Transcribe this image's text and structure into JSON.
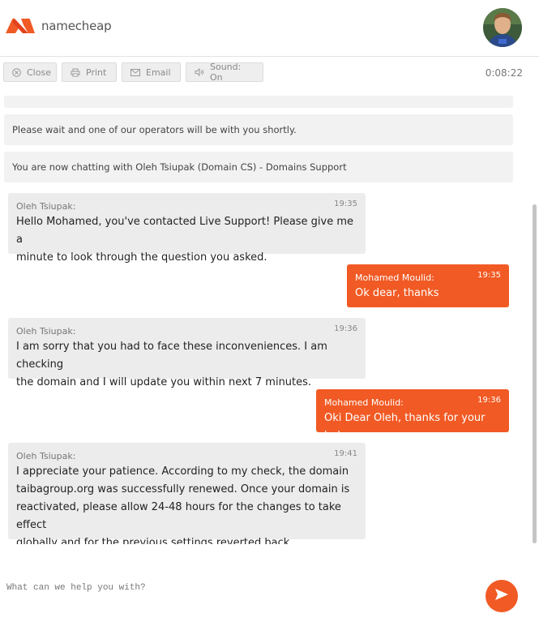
{
  "header": {
    "logo_text": "namecheap",
    "brand_color": "#f15a24"
  },
  "toolbar": {
    "close_label": "Close",
    "print_label": "Print",
    "email_label": "Email",
    "sound_label": "Sound: On",
    "timer": "0:08:22"
  },
  "system_messages": [
    "Please wait and one of our operators will be with you shortly.",
    "You are now chatting with Oleh Tsiupak (Domain CS) - Domains Support"
  ],
  "messages": [
    {
      "sender": "Oleh Tsiupak:",
      "time": "19:35",
      "role": "operator",
      "lines": [
        "Hello Mohamed, you've contacted Live Support! Please give me a",
        "minute to look through the question you asked."
      ]
    },
    {
      "sender": "Mohamed Moulid:",
      "time": "19:35",
      "role": "user",
      "lines": [
        "Ok dear, thanks"
      ]
    },
    {
      "sender": "Oleh Tsiupak:",
      "time": "19:36",
      "role": "operator",
      "lines": [
        "I am sorry that you had to face these inconveniences. I am checking",
        "the domain and I will update you within next 7 minutes."
      ]
    },
    {
      "sender": "Mohamed Moulid:",
      "time": "19:36",
      "role": "user",
      "lines": [
        "Oki Dear Oleh, thanks for your help"
      ]
    },
    {
      "sender": "Oleh Tsiupak:",
      "time": "19:41",
      "role": "operator",
      "lines": [
        "I appreciate your patience. According to my check, the domain",
        "taibagroup.org was successfully renewed. Once your domain is",
        "reactivated, please allow 24-48 hours for the changes to take effect",
        "globally and for the previous settings reverted back."
      ]
    }
  ],
  "input": {
    "placeholder": "What can we help you with?",
    "value": ""
  },
  "icons": {
    "close": "close-circle-icon",
    "print": "printer-icon",
    "email": "envelope-icon",
    "sound": "speaker-icon",
    "send": "send-arrow-icon"
  }
}
